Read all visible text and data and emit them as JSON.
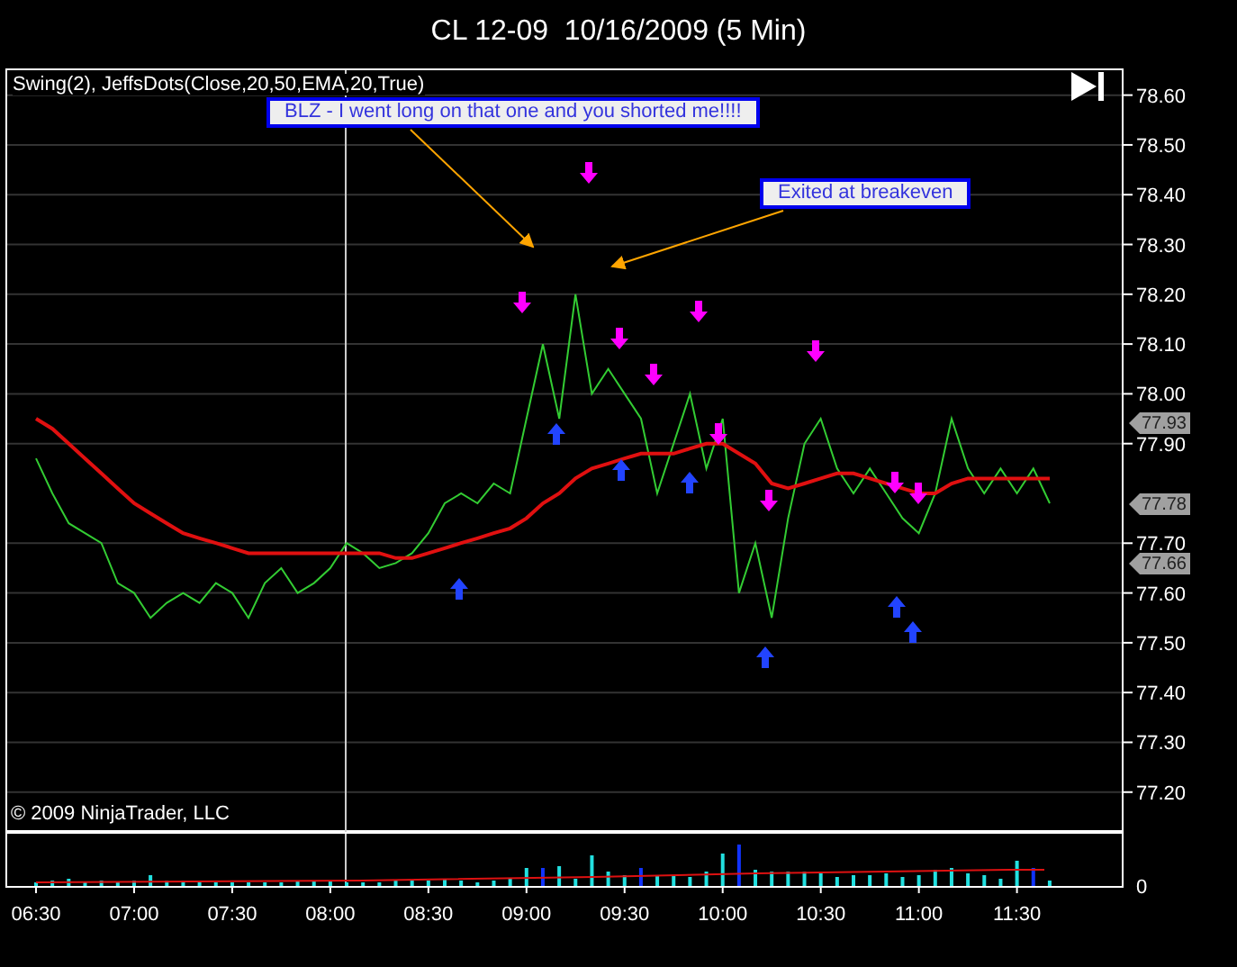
{
  "title": "CL 12-09  10/16/2009 (5 Min)",
  "indicator_label": "Swing(2), JeffsDots(Close,20,50,EMA,20,True)",
  "annotations": [
    {
      "text": "BLZ - I went long on that one and you shorted me!!!!"
    },
    {
      "text": "Exited at breakeven"
    }
  ],
  "price_markers": [
    {
      "label": "77.93"
    },
    {
      "label": "77.78"
    },
    {
      "label": "77.66"
    }
  ],
  "copyright": "© 2009 NinjaTrader, LLC",
  "price_chart": {
    "chart_data": {
      "type": "line",
      "categories": [
        "06:30",
        null,
        null,
        null,
        null,
        null,
        "07:00",
        null,
        null,
        null,
        null,
        null,
        "07:30",
        null,
        null,
        null,
        null,
        null,
        "08:00",
        null,
        null,
        null,
        null,
        null,
        "08:30",
        null,
        null,
        null,
        null,
        null,
        "09:00",
        null,
        null,
        null,
        null,
        null,
        "09:30",
        null,
        null,
        null,
        null,
        null,
        "10:00",
        null,
        null,
        null,
        null,
        null,
        "10:30",
        null,
        null,
        null,
        null,
        null,
        "11:00",
        null,
        null,
        null,
        null,
        null,
        "11:30",
        null,
        null
      ],
      "grid": true,
      "series": [
        {
          "color": "#33cc33",
          "values": [
            77.87,
            77.8,
            77.74,
            77.72,
            77.7,
            77.62,
            77.6,
            77.55,
            77.58,
            77.6,
            77.58,
            77.62,
            77.6,
            77.55,
            77.62,
            77.65,
            77.6,
            77.62,
            77.65,
            77.7,
            77.68,
            77.65,
            77.66,
            77.68,
            77.72,
            77.78,
            77.8,
            77.78,
            77.82,
            77.8,
            77.95,
            78.1,
            77.95,
            78.2,
            78.0,
            78.05,
            78.0,
            77.95,
            77.8,
            77.9,
            78.0,
            77.85,
            77.95,
            77.6,
            77.7,
            77.55,
            77.75,
            77.9,
            77.95,
            77.85,
            77.8,
            77.85,
            77.8,
            77.75,
            77.72,
            77.8,
            77.95,
            77.85,
            77.8,
            77.85,
            77.8,
            77.85,
            77.78
          ]
        },
        {
          "color": "#e01010",
          "values": [
            77.95,
            77.93,
            77.9,
            77.87,
            77.84,
            77.81,
            77.78,
            77.76,
            77.74,
            77.72,
            77.71,
            77.7,
            77.69,
            77.68,
            77.68,
            77.68,
            77.68,
            77.68,
            77.68,
            77.68,
            77.68,
            77.68,
            77.67,
            77.67,
            77.68,
            77.69,
            77.7,
            77.71,
            77.72,
            77.73,
            77.75,
            77.78,
            77.8,
            77.83,
            77.85,
            77.86,
            77.87,
            77.88,
            77.88,
            77.88,
            77.89,
            77.9,
            77.9,
            77.88,
            77.86,
            77.82,
            77.81,
            77.82,
            77.83,
            77.84,
            77.84,
            77.83,
            77.82,
            77.81,
            77.8,
            77.8,
            77.82,
            77.83,
            77.83,
            77.83,
            77.83,
            77.83,
            77.83
          ]
        }
      ],
      "ylim": [
        77.12,
        78.65
      ],
      "yticks": [
        {
          "value": 77.2,
          "label": "77.20"
        },
        {
          "value": 77.3,
          "label": "77.30"
        },
        {
          "value": 77.4,
          "label": "77.40"
        },
        {
          "value": 77.5,
          "label": "77.50"
        },
        {
          "value": 77.6,
          "label": "77.60"
        },
        {
          "value": 77.7,
          "label": "77.70"
        },
        {
          "value": 77.9,
          "label": "77.90"
        },
        {
          "value": 78.0,
          "label": "78.00"
        },
        {
          "value": 78.1,
          "label": "78.10"
        },
        {
          "value": 78.2,
          "label": "78.20"
        },
        {
          "value": 78.3,
          "label": "78.30"
        },
        {
          "value": 78.4,
          "label": "78.40"
        },
        {
          "value": 78.5,
          "label": "78.50"
        },
        {
          "value": 78.6,
          "label": "78.60"
        }
      ]
    }
  },
  "volume_chart": {
    "zero_label": "0"
  }
}
